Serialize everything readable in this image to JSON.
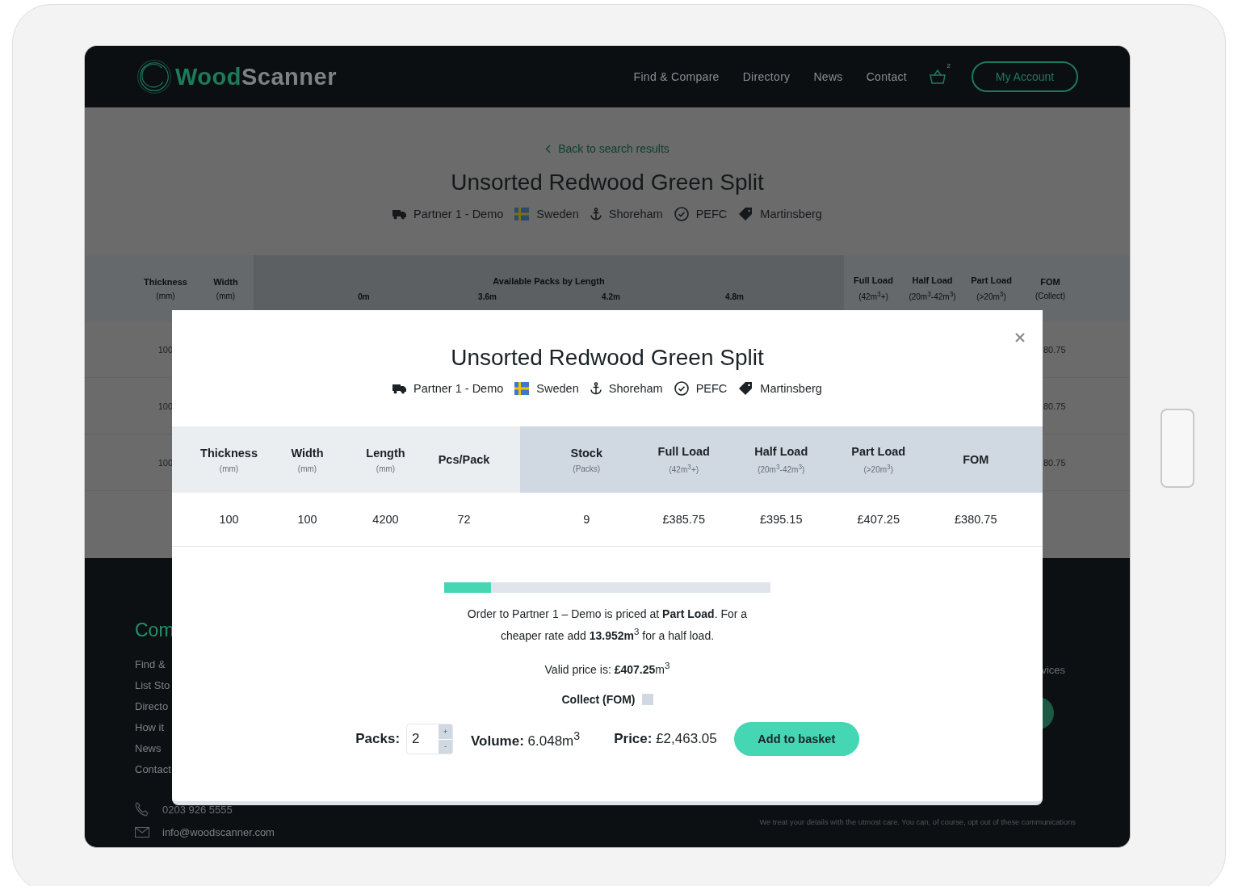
{
  "header": {
    "logo": [
      "Wood",
      "Scanner"
    ],
    "nav": [
      "Find & Compare",
      "Directory",
      "News",
      "Contact"
    ],
    "cart_count": "2",
    "account_button": "My Account"
  },
  "page": {
    "back_link": "Back to search results",
    "title": "Unsorted Redwood Green Split",
    "meta": [
      {
        "kind": "supplier",
        "text": "Partner 1 - Demo"
      },
      {
        "kind": "origin",
        "text": "Sweden"
      },
      {
        "kind": "port",
        "text": "Shoreham"
      },
      {
        "kind": "certification",
        "text": "PEFC"
      },
      {
        "kind": "brand",
        "text": "Martinsberg"
      }
    ],
    "table": {
      "columns": [
        {
          "label": "Thickness",
          "unit": "(mm)"
        },
        {
          "label": "Width",
          "unit": "(mm)"
        }
      ],
      "group_label": "Available Packs by Length",
      "lengths": [
        "0m",
        "3.6m",
        "4.2m",
        "4.8m"
      ],
      "load_columns": [
        {
          "label": "Full Load",
          "unit": "(42m$^{3}$+)"
        },
        {
          "label": "Half Load",
          "unit": "(20m$^{3}$-42m$^{3}$)"
        },
        {
          "label": "Part Load",
          "unit": "(>20m$^{3}$)"
        },
        {
          "label": "FOM",
          "unit": "(Collect)"
        }
      ],
      "rows": [
        {
          "thickness": "100",
          "fom": "80.75"
        },
        {
          "thickness": "100",
          "fom": "80.75"
        },
        {
          "thickness": "100",
          "fom": "80.75"
        }
      ]
    }
  },
  "footer": {
    "heading": "Com",
    "links": [
      "Find &",
      "List Sto",
      "Directo",
      "How it",
      "News",
      "Contact"
    ],
    "phone": "0203 926 5555",
    "email": "info@woodscanner.com",
    "right_text": "vices",
    "note": "We treat your details with the utmost care. You can, of course, opt out of these communications"
  },
  "modal": {
    "title": "Unsorted Redwood Green Split",
    "meta": [
      {
        "kind": "supplier",
        "text": "Partner 1 - Demo"
      },
      {
        "kind": "origin",
        "text": "Sweden"
      },
      {
        "kind": "port",
        "text": "Shoreham"
      },
      {
        "kind": "certification",
        "text": "PEFC"
      },
      {
        "kind": "brand",
        "text": "Martinsberg"
      }
    ],
    "product_columns": [
      {
        "label": "Thickness",
        "unit": "(mm)"
      },
      {
        "label": "Width",
        "unit": "(mm)"
      },
      {
        "label": "Length",
        "unit": "(mm)"
      },
      {
        "label": "Pcs/Pack"
      }
    ],
    "price_columns": [
      {
        "label": "Stock",
        "unit": "(Packs)"
      },
      {
        "label": "Full Load",
        "unit": "(42m$^{3}$+)"
      },
      {
        "label": "Half Load",
        "unit": "(20m$^{3}$-42m$^{3}$)"
      },
      {
        "label": "Part Load",
        "unit": "(>20m$^{3}$)"
      },
      {
        "label": "FOM"
      }
    ],
    "row": [
      "100",
      "100",
      "4200",
      "72",
      "9",
      "£385.75",
      "£395.15",
      "£407.25",
      "£380.75"
    ],
    "progress": {
      "level": 0.144
    },
    "message": "Order to Partner 1 – Demo is priced at **Part Load**. For a cheaper rate add **13.952m**$^{3}$ for a half load.",
    "valid_price": "Valid price is: **£407.25**m$^{3}$",
    "collect": {
      "label": "Collect (FOM)",
      "checked": false
    },
    "packs": {
      "label": "Packs:",
      "value": "2",
      "increment": "+",
      "decrement": "-"
    },
    "volume": "**Volume:** 6.048m$^{3}$",
    "price": "**Price:** £2,463.05",
    "add_button": "Add to basket"
  }
}
